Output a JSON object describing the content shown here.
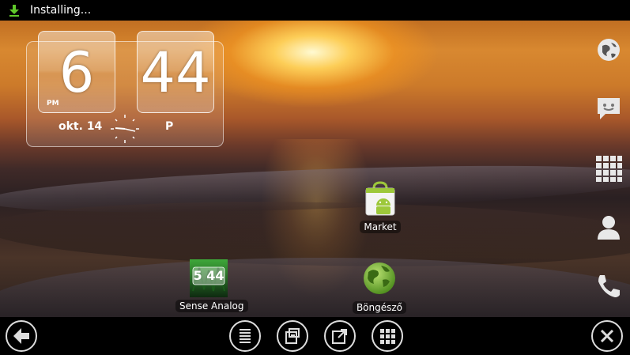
{
  "status_bar": {
    "text": "Installing...",
    "icon": "download-icon"
  },
  "clock_widget": {
    "hours": "6",
    "minutes": "44",
    "ampm": "PM",
    "date": "okt. 14",
    "weekday": "P"
  },
  "home_icons": [
    {
      "label": "Market",
      "icon": "market-icon"
    },
    {
      "label": "Sense Analog",
      "icon": "sense-analog-clock-icon",
      "widget_text": "5 44"
    },
    {
      "label": "Böngésző",
      "icon": "browser-globe-icon"
    }
  ],
  "dock": [
    "globe-icon",
    "messaging-icon",
    "app-grid-icon",
    "contacts-icon",
    "phone-icon"
  ],
  "bottom_bar": [
    "back-icon",
    "list-icon",
    "copy-icon",
    "external-icon",
    "grid-icon",
    "close-icon"
  ],
  "colors": {
    "status_icon": "#5fc82a",
    "android_green": "#9dc83a"
  }
}
